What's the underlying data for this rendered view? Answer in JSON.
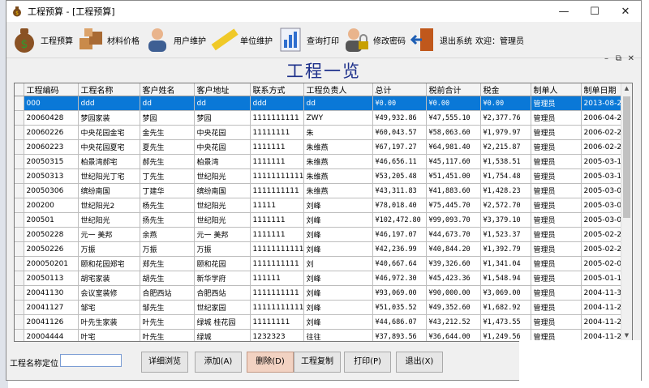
{
  "window": {
    "title": "工程预算 - [工程预算]"
  },
  "toolbar": {
    "items": [
      {
        "label": "工程预算",
        "icon": "money-bag-icon"
      },
      {
        "label": "材料价格",
        "icon": "boxes-icon"
      },
      {
        "label": "用户维护",
        "icon": "user-icon"
      },
      {
        "label": "单位维护",
        "icon": "ruler-icon"
      },
      {
        "label": "查询打印",
        "icon": "chart-icon"
      },
      {
        "label": "修改密码",
        "icon": "lock-user-icon"
      },
      {
        "label": "退出系统",
        "icon": "exit-door-icon"
      }
    ],
    "welcome": "欢迎：管理员"
  },
  "header": {
    "title": "工程一览"
  },
  "grid": {
    "columns": [
      "工程编码",
      "工程名称",
      "客户姓名",
      "客户地址",
      "联系方式",
      "工程负责人",
      "总计",
      "税前合计",
      "税金",
      "制单人",
      "制单日期"
    ],
    "rows": [
      [
        "000",
        "ddd",
        "dd",
        "dd",
        "ddd",
        "dd",
        "¥0.00",
        "¥0.00",
        "¥0.00",
        "管理员",
        "2013-08-2..."
      ],
      [
        "20060428",
        "梦园家装",
        "梦园",
        "梦园",
        "1111111111",
        "ZWY",
        "¥49,932.86",
        "¥47,555.10",
        "¥2,377.76",
        "管理员",
        "2006-04-2..."
      ],
      [
        "20060226",
        "中央花园金宅",
        "金先生",
        "中央花园",
        "11111111",
        "朱",
        "¥60,043.57",
        "¥58,063.60",
        "¥1,979.97",
        "管理员",
        "2006-02-2..."
      ],
      [
        "20060223",
        "中央花园夏宅",
        "夏先生",
        "中央花园",
        "1111111",
        "朱维燕",
        "¥67,197.27",
        "¥64,981.40",
        "¥2,215.87",
        "管理员",
        "2006-02-2..."
      ],
      [
        "20050315",
        "柏景湾郝宅",
        "郝先生",
        "柏景湾",
        "1111111",
        "朱维燕",
        "¥46,656.11",
        "¥45,117.60",
        "¥1,538.51",
        "管理员",
        "2005-03-1..."
      ],
      [
        "20050313",
        "世纪阳光丁宅",
        "丁先生",
        "世纪阳光",
        "11111111111",
        "朱维燕",
        "¥53,205.48",
        "¥51,451.00",
        "¥1,754.48",
        "管理员",
        "2005-03-1..."
      ],
      [
        "20050306",
        "缤纷南国",
        "丁建华",
        "缤纷南国",
        "1111111111",
        "朱维燕",
        "¥43,311.83",
        "¥41,883.60",
        "¥1,428.23",
        "管理员",
        "2005-03-0..."
      ],
      [
        "200200",
        "世纪阳光2",
        "杨先生",
        "世纪阳光",
        "11111",
        "刘峰",
        "¥78,018.40",
        "¥75,445.70",
        "¥2,572.70",
        "管理员",
        "2005-03-0..."
      ],
      [
        "200501",
        "世纪阳光",
        "扬先生",
        "世纪阳光",
        "1111111",
        "刘峰",
        "¥102,472.80",
        "¥99,093.70",
        "¥3,379.10",
        "管理员",
        "2005-03-0..."
      ],
      [
        "20050228",
        "元一 美邦",
        "余燕",
        "元一 美邦",
        "1111111",
        "刘峰",
        "¥46,197.07",
        "¥44,673.70",
        "¥1,523.37",
        "管理员",
        "2005-02-2..."
      ],
      [
        "20050226",
        "万振",
        "万振",
        "万振",
        "11111111111",
        "刘峰",
        "¥42,236.99",
        "¥40,844.20",
        "¥1,392.79",
        "管理员",
        "2005-02-2..."
      ],
      [
        "200050201",
        "颐和花园郑宅",
        "郑先生",
        "颐和花园",
        "1111111111",
        "刘",
        "¥40,667.64",
        "¥39,326.60",
        "¥1,341.04",
        "管理员",
        "2005-02-0..."
      ],
      [
        "20050113",
        "胡宅家装",
        "胡先生",
        "新华学府",
        "111111",
        "刘峰",
        "¥46,972.30",
        "¥45,423.36",
        "¥1,548.94",
        "管理员",
        "2005-01-1..."
      ],
      [
        "20041130",
        "会议室装修",
        "合肥西站",
        "合肥西站",
        "1111111111",
        "刘峰",
        "¥93,069.00",
        "¥90,000.00",
        "¥3,069.00",
        "管理员",
        "2004-11-3..."
      ],
      [
        "20041127",
        "邹宅",
        "邹先生",
        "世纪家园",
        "111111111111",
        "刘峰",
        "¥51,035.52",
        "¥49,352.60",
        "¥1,682.92",
        "管理员",
        "2004-11-2..."
      ],
      [
        "20041126",
        "叶先生家装",
        "叶先生",
        "绿城 桂花园",
        "11111111",
        "刘峰",
        "¥44,686.07",
        "¥43,212.52",
        "¥1,473.55",
        "管理员",
        "2004-11-2..."
      ],
      [
        "20004444",
        "叶宅",
        "叶先生",
        "绿城",
        "1232323",
        "往往",
        "¥37,893.56",
        "¥36,644.00",
        "¥1,249.56",
        "管理员",
        "2004-11-2..."
      ]
    ]
  },
  "bottom": {
    "locate_label": "工程名称定位",
    "locate_value": "",
    "buttons": [
      "详细浏览",
      "添加(A)",
      "删除(D)",
      "工程复制",
      "打印(P)",
      "退出(X)"
    ]
  },
  "colors": {
    "selection": "#0a78d7",
    "title_text": "#1c2f8a",
    "delete_button": "#f2d2c2"
  }
}
